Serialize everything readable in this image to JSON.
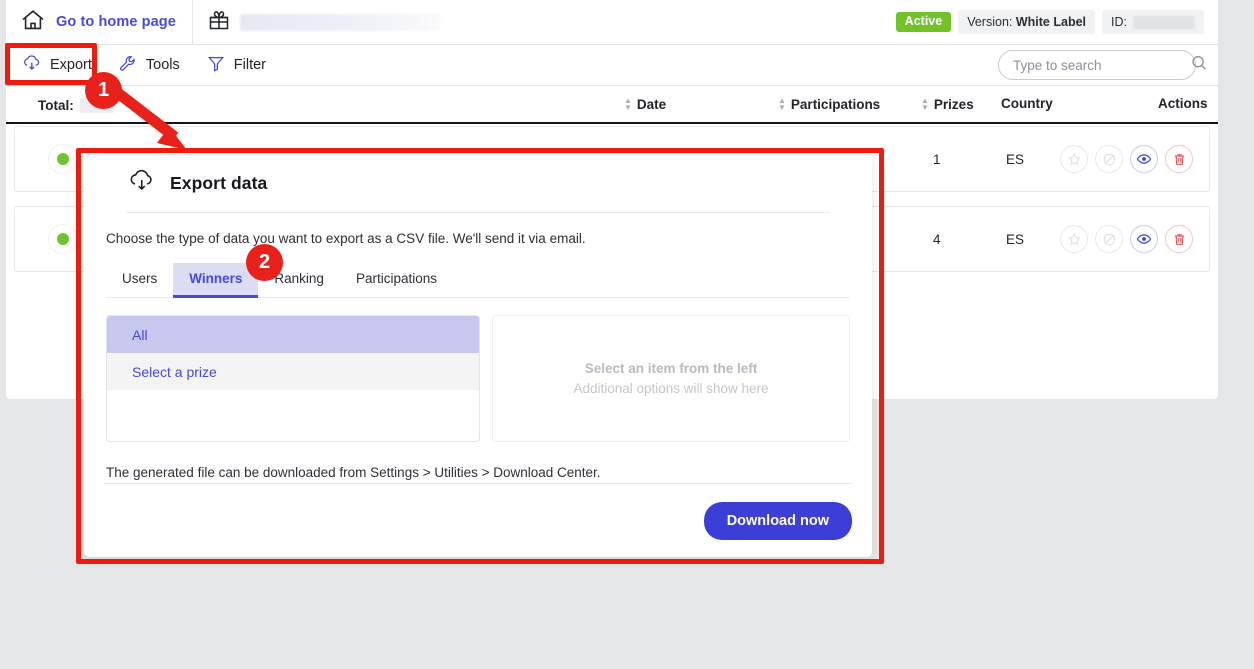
{
  "header": {
    "home_link": "Go to home page",
    "gift_icon": "gift-icon",
    "home_icon": "home-icon",
    "status_badge": "Active",
    "version_prefix": "Version:",
    "version_value": "White Label",
    "id_label": "ID:"
  },
  "toolbar": {
    "export_label": "Export",
    "tools_label": "Tools",
    "filter_label": "Filter",
    "export_icon": "cloud-download-icon",
    "tools_icon": "wrench-icon",
    "filter_icon": "funnel-icon",
    "search_placeholder": "Type to search",
    "search_value": "",
    "search_icon": "search-icon"
  },
  "table": {
    "total_label": "Total:",
    "columns": [
      {
        "label": "Date",
        "sortable": true
      },
      {
        "label": "Participations",
        "sortable": true
      },
      {
        "label": "Prizes",
        "sortable": true
      },
      {
        "label": "Country",
        "sortable": false
      },
      {
        "label": "Actions",
        "sortable": false
      }
    ],
    "rows": [
      {
        "status": "active",
        "prizes": "1",
        "country": "ES"
      },
      {
        "status": "active",
        "prizes": "4",
        "country": "ES"
      }
    ],
    "action_icons": [
      "star-icon",
      "block-icon",
      "eye-icon",
      "trash-icon"
    ]
  },
  "modal": {
    "title": "Export data",
    "title_icon": "cloud-download-icon",
    "description": "Choose the type of data you want to export as a CSV file. We'll send it via email.",
    "tabs": [
      {
        "label": "Users",
        "active": false
      },
      {
        "label": "Winners",
        "active": true
      },
      {
        "label": "Ranking",
        "active": false
      },
      {
        "label": "Participations",
        "active": false
      }
    ],
    "options": [
      {
        "label": "All",
        "selected": true
      },
      {
        "label": "Select a prize",
        "selected": false
      }
    ],
    "right_pane_title": "Select an item from the left",
    "right_pane_subtitle": "Additional options will show here",
    "note": "The generated file can be downloaded from Settings > Utilities > Download Center.",
    "primary_button": "Download now"
  },
  "annotations": {
    "badge_one": "1",
    "badge_two": "2",
    "color": "#e8211a"
  },
  "colors": {
    "accent": "#4549e0",
    "primary_button": "#3b3fd6",
    "active_green": "#72c32a",
    "tab_active_bg": "#dcdcf3",
    "option_selected_bg": "#c8c8ee",
    "annotation_red": "#f01a0f",
    "page_bg": "#e4e6e8"
  }
}
